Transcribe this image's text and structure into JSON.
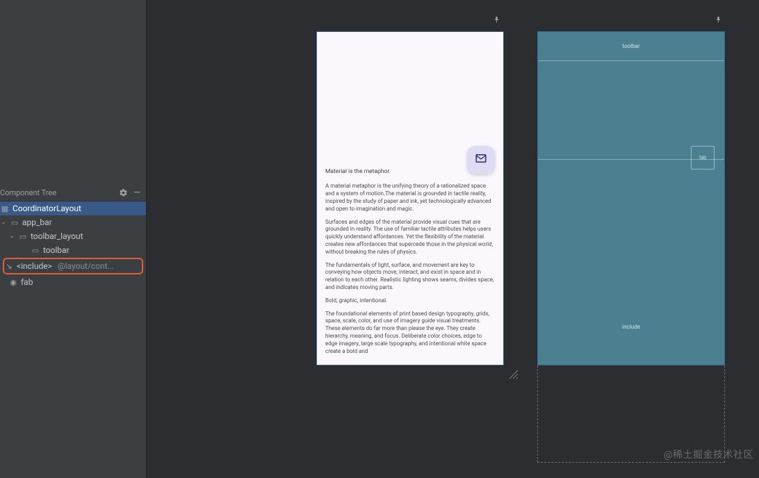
{
  "panel": {
    "title": "Component Tree",
    "gear_icon": "⚙",
    "collapse_icon": "—"
  },
  "tree": {
    "root": {
      "label": "CoordinatorLayout"
    },
    "app_bar": {
      "label": "app_bar"
    },
    "toolbar_layout": {
      "label": "toolbar_layout"
    },
    "toolbar": {
      "label": "toolbar"
    },
    "include": {
      "label": "<include>",
      "meta": "@layout/cont..."
    },
    "fab": {
      "label": "fab"
    }
  },
  "design": {
    "heading": "Material is the metaphor.",
    "p1": "A material metaphor is the unifying theory of a rationalized space and a system of motion.The material is grounded in tactile reality, inspired by the study of paper and ink, yet technologically advanced and open to imagination and magic.",
    "p2": "Surfaces and edges of the material provide visual cues that are grounded in reality. The use of familiar tactile attributes helps users quickly understand affordances. Yet the flexibility of the material creates new affordances that supercede those in the physical world, without breaking the rules of physics.",
    "p3": "The fundamentals of light, surface, and movement are key to conveying how objects move, interact, and exist in space and in relation to each other. Realistic lighting shows seams, divides space, and indicates moving parts.",
    "p4": "Bold, graphic, intentional.",
    "p5": "The foundational elements of print based design typography, grids, space, scale, color, and use of imagery guide visual treatments. These elements do far more than please the eye. They create hierarchy, meaning, and focus. Deliberate color choices, edge to edge imagery, large scale typography, and intentional white space create a bold and"
  },
  "blueprint": {
    "toolbar_label": "toolbar",
    "fab_label": "fab",
    "include_label": "include"
  },
  "watermark": "@稀土掘金技术社区"
}
